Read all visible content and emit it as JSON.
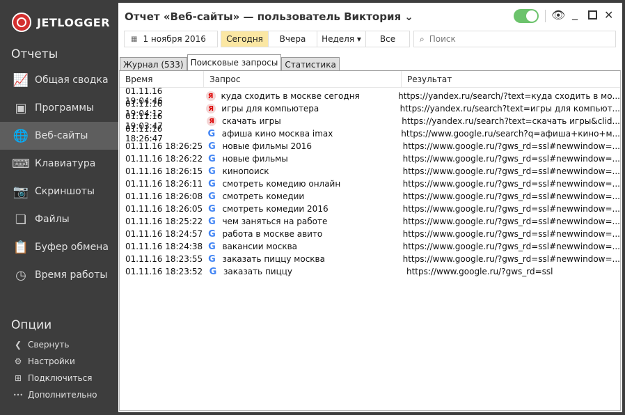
{
  "app": {
    "logo": "JETLOGGER"
  },
  "sidebar": {
    "reports_title": "Отчеты",
    "items": [
      {
        "label": "Общая сводка",
        "icon": "chart-icon"
      },
      {
        "label": "Программы",
        "icon": "programs-icon"
      },
      {
        "label": "Веб-сайты",
        "icon": "www-icon"
      },
      {
        "label": "Клавиатура",
        "icon": "keyboard-icon"
      },
      {
        "label": "Скриншоты",
        "icon": "camera-icon"
      },
      {
        "label": "Файлы",
        "icon": "files-icon"
      },
      {
        "label": "Буфер обмена",
        "icon": "clipboard-icon"
      },
      {
        "label": "Время работы",
        "icon": "clock-icon"
      }
    ],
    "options_title": "Опции",
    "options": [
      {
        "label": "Свернуть"
      },
      {
        "label": "Настройки"
      },
      {
        "label": "Подключиться"
      },
      {
        "label": "Дополнительно"
      }
    ]
  },
  "header": {
    "title": "Отчет «Веб-сайты» — пользователь Виктория ⌄"
  },
  "toolbar": {
    "date": "1 ноября 2016",
    "periods": [
      "Сегодня",
      "Вчера",
      "Неделя ▾",
      "Все"
    ],
    "search_placeholder": "Поиск"
  },
  "tabs": [
    "Журнал (533)",
    "Поисковые запросы",
    "Статистика"
  ],
  "table": {
    "headers": [
      "Время",
      "Запрос",
      "Результат"
    ],
    "rows": [
      {
        "time": "01.11.16 19:04:46",
        "engine": "Я",
        "query": "куда сходить в москве сегодня",
        "result": "https://yandex.ru/search/?text=куда сходить в мо..."
      },
      {
        "time": "01.11.16 19:04:12",
        "engine": "Я",
        "query": "игры для компьютера",
        "result": "https://yandex.ru/search?text=игры для компьют..."
      },
      {
        "time": "01.11.16 19:03:47",
        "engine": "Я",
        "query": "скачать игры",
        "result": "https://yandex.ru/search?text=скачать игры&clid..."
      },
      {
        "time": "01.11.16 18:26:47",
        "engine": "G",
        "query": "афиша кино москва imax",
        "result": "https://www.google.ru/search?q=афиша+кино+м..."
      },
      {
        "time": "01.11.16 18:26:25",
        "engine": "G",
        "query": "новые фильмы 2016",
        "result": "https://www.google.ru/?gws_rd=ssl#newwindow=..."
      },
      {
        "time": "01.11.16 18:26:22",
        "engine": "G",
        "query": "новые фильмы",
        "result": "https://www.google.ru/?gws_rd=ssl#newwindow=..."
      },
      {
        "time": "01.11.16 18:26:15",
        "engine": "G",
        "query": "кинопоиск",
        "result": "https://www.google.ru/?gws_rd=ssl#newwindow=..."
      },
      {
        "time": "01.11.16 18:26:11",
        "engine": "G",
        "query": "смотреть комедию онлайн",
        "result": "https://www.google.ru/?gws_rd=ssl#newwindow=..."
      },
      {
        "time": "01.11.16 18:26:08",
        "engine": "G",
        "query": "смотреть комедии",
        "result": "https://www.google.ru/?gws_rd=ssl#newwindow=..."
      },
      {
        "time": "01.11.16 18:26:05",
        "engine": "G",
        "query": "смотреть комедии 2016",
        "result": "https://www.google.ru/?gws_rd=ssl#newwindow=..."
      },
      {
        "time": "01.11.16 18:25:22",
        "engine": "G",
        "query": "чем заняться на работе",
        "result": "https://www.google.ru/?gws_rd=ssl#newwindow=..."
      },
      {
        "time": "01.11.16 18:24:57",
        "engine": "G",
        "query": "работа в москве авито",
        "result": "https://www.google.ru/?gws_rd=ssl#newwindow=..."
      },
      {
        "time": "01.11.16 18:24:38",
        "engine": "G",
        "query": "вакансии москва",
        "result": "https://www.google.ru/?gws_rd=ssl#newwindow=..."
      },
      {
        "time": "01.11.16 18:23:55",
        "engine": "G",
        "query": "заказать пиццу москва",
        "result": "https://www.google.ru/?gws_rd=ssl#newwindow=..."
      },
      {
        "time": "01.11.16 18:23:52",
        "engine": "G",
        "query": "заказать пиццу",
        "result": "https://www.google.ru/?gws_rd=ssl"
      }
    ]
  }
}
